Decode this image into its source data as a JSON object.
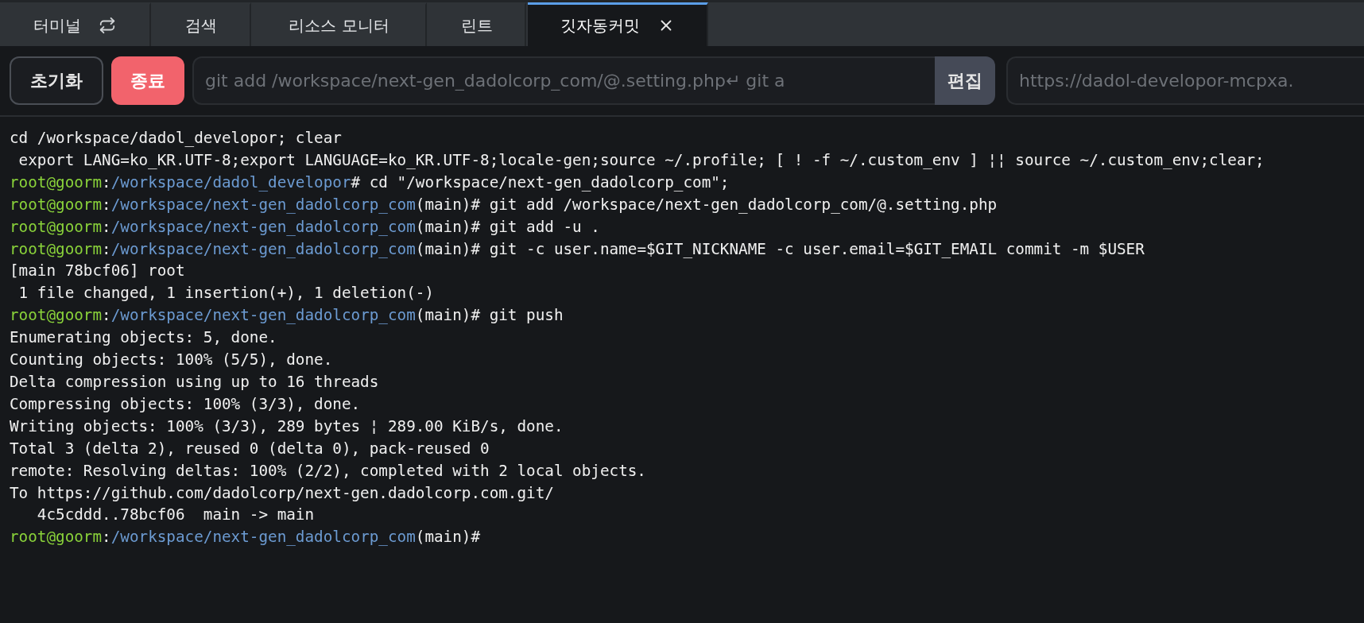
{
  "tabs": [
    {
      "label": "터미널",
      "kind": "terminal",
      "selected": false
    },
    {
      "label": "검색",
      "kind": "tool",
      "selected": false
    },
    {
      "label": "리소스 모니터",
      "kind": "tool",
      "selected": false
    },
    {
      "label": "린트",
      "kind": "tool",
      "selected": false
    },
    {
      "label": "깃자동커밋",
      "kind": "tool",
      "selected": true
    }
  ],
  "toolbar": {
    "reset_button": "초기화",
    "stop_button": "종료",
    "command_field": {
      "value": "git add /workspace/next-gen_dadolcorp_com/@.setting.php↵ git a"
    },
    "edit_button": "편집",
    "url_field": {
      "value": "https://dadol-developor-mcpxa."
    }
  },
  "terminal": {
    "lines": [
      {
        "segments": [
          {
            "kind": "plain",
            "text": "cd /workspace/dadol_developor; clear"
          }
        ]
      },
      {
        "segments": [
          {
            "kind": "plain",
            "text": " export LANG=ko_KR.UTF-8;export LANGUAGE=ko_KR.UTF-8;locale-gen;source ~/.profile; [ ! -f ~/.custom_env ] ¦¦ source ~/.custom_env;clear;"
          }
        ]
      },
      {
        "segments": [
          {
            "kind": "user",
            "text": "root@goorm"
          },
          {
            "kind": "plain",
            "text": ":"
          },
          {
            "kind": "path",
            "text": "/workspace/dadol_developor"
          },
          {
            "kind": "plain",
            "text": "# cd \"/workspace/next-gen_dadolcorp_com\";"
          }
        ]
      },
      {
        "segments": [
          {
            "kind": "user",
            "text": "root@goorm"
          },
          {
            "kind": "plain",
            "text": ":"
          },
          {
            "kind": "path",
            "text": "/workspace/next-gen_dadolcorp_com"
          },
          {
            "kind": "plain",
            "text": "(main)# git add /workspace/next-gen_dadolcorp_com/@.setting.php"
          }
        ]
      },
      {
        "segments": [
          {
            "kind": "user",
            "text": "root@goorm"
          },
          {
            "kind": "plain",
            "text": ":"
          },
          {
            "kind": "path",
            "text": "/workspace/next-gen_dadolcorp_com"
          },
          {
            "kind": "plain",
            "text": "(main)# git add -u ."
          }
        ]
      },
      {
        "segments": [
          {
            "kind": "user",
            "text": "root@goorm"
          },
          {
            "kind": "plain",
            "text": ":"
          },
          {
            "kind": "path",
            "text": "/workspace/next-gen_dadolcorp_com"
          },
          {
            "kind": "plain",
            "text": "(main)# git -c user.name=$GIT_NICKNAME -c user.email=$GIT_EMAIL commit -m $USER"
          }
        ]
      },
      {
        "segments": [
          {
            "kind": "plain",
            "text": "[main 78bcf06] root"
          }
        ]
      },
      {
        "segments": [
          {
            "kind": "plain",
            "text": " 1 file changed, 1 insertion(+), 1 deletion(-)"
          }
        ]
      },
      {
        "segments": [
          {
            "kind": "user",
            "text": "root@goorm"
          },
          {
            "kind": "plain",
            "text": ":"
          },
          {
            "kind": "path",
            "text": "/workspace/next-gen_dadolcorp_com"
          },
          {
            "kind": "plain",
            "text": "(main)# git push"
          }
        ]
      },
      {
        "segments": [
          {
            "kind": "plain",
            "text": "Enumerating objects: 5, done."
          }
        ]
      },
      {
        "segments": [
          {
            "kind": "plain",
            "text": "Counting objects: 100% (5/5), done."
          }
        ]
      },
      {
        "segments": [
          {
            "kind": "plain",
            "text": "Delta compression using up to 16 threads"
          }
        ]
      },
      {
        "segments": [
          {
            "kind": "plain",
            "text": "Compressing objects: 100% (3/3), done."
          }
        ]
      },
      {
        "segments": [
          {
            "kind": "plain",
            "text": "Writing objects: 100% (3/3), 289 bytes ¦ 289.00 KiB/s, done."
          }
        ]
      },
      {
        "segments": [
          {
            "kind": "plain",
            "text": "Total 3 (delta 2), reused 0 (delta 0), pack-reused 0"
          }
        ]
      },
      {
        "segments": [
          {
            "kind": "plain",
            "text": "remote: Resolving deltas: 100% (2/2), completed with 2 local objects."
          }
        ]
      },
      {
        "segments": [
          {
            "kind": "plain",
            "text": "To https://github.com/dadolcorp/next-gen.dadolcorp.com.git/"
          }
        ]
      },
      {
        "segments": [
          {
            "kind": "plain",
            "text": "   4c5cddd..78bcf06  main -> main"
          }
        ]
      },
      {
        "segments": [
          {
            "kind": "user",
            "text": "root@goorm"
          },
          {
            "kind": "plain",
            "text": ":"
          },
          {
            "kind": "path",
            "text": "/workspace/next-gen_dadolcorp_com"
          },
          {
            "kind": "plain",
            "text": "(main)#"
          }
        ]
      }
    ]
  }
}
